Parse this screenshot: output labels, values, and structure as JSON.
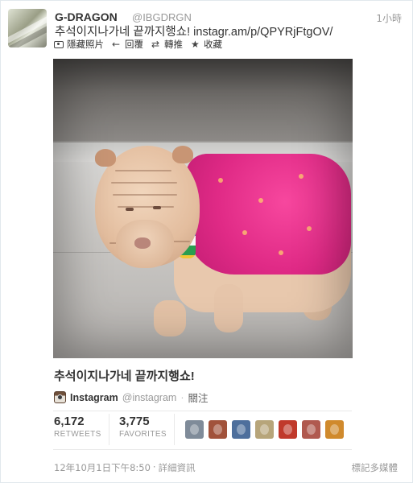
{
  "tweet": {
    "name": "G-DRAGON",
    "handle": "@IBGDRGN",
    "time": "1小時",
    "text": "추석이지나가네 끝까지행쇼! instagr.am/p/QPYRjFtgOV/"
  },
  "actions": [
    {
      "label": "隱藏照片",
      "icon": "media-icon"
    },
    {
      "label": "回覆",
      "icon": "reply-icon"
    },
    {
      "label": "轉推",
      "icon": "retweet-icon"
    },
    {
      "label": "收藏",
      "icon": "star-icon"
    }
  ],
  "media": {
    "caption": "추석이지나가네 끝까지행쇼!",
    "source_name": "Instagram",
    "source_handle": "@instagram",
    "follow_label": "關注"
  },
  "stats": {
    "retweets_count": "6,172",
    "retweets_label": "RETWEETS",
    "favorites_count": "3,775",
    "favorites_label": "FAVORITES"
  },
  "favoriters": [
    {
      "name": "user-avatar-1",
      "color": "#7f8b99"
    },
    {
      "name": "user-avatar-2",
      "color": "#a1523b"
    },
    {
      "name": "user-avatar-3",
      "color": "#4e6f9c"
    },
    {
      "name": "user-avatar-4",
      "color": "#b7a57a"
    },
    {
      "name": "user-avatar-5",
      "color": "#c0392b"
    },
    {
      "name": "user-avatar-6",
      "color": "#b0594f"
    },
    {
      "name": "user-avatar-7",
      "color": "#d08a2d"
    }
  ],
  "footer": {
    "timestamp": "12年10月1日下午8:50",
    "separator": "·",
    "details_label": "詳細資訊",
    "flag_label": "標記多媒體"
  }
}
